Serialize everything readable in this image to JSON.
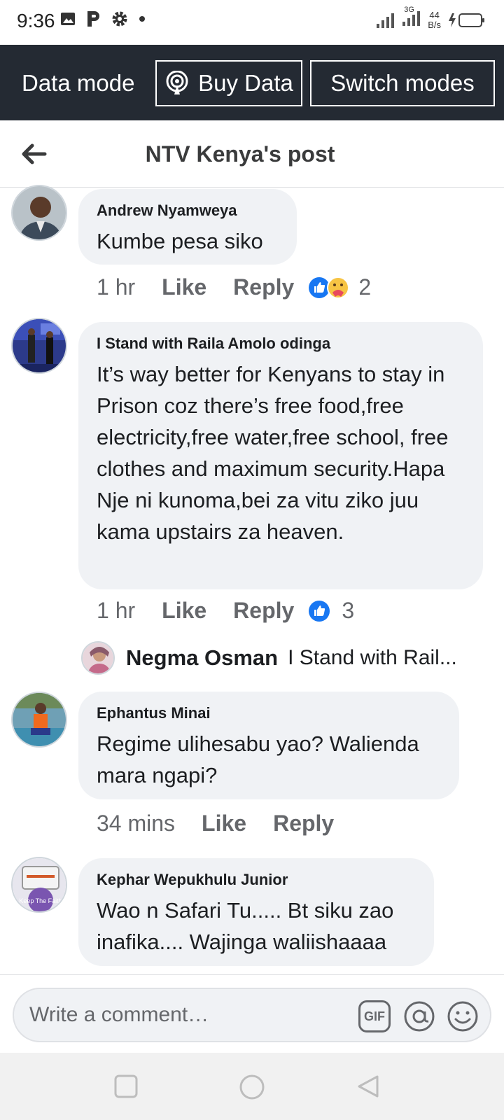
{
  "status_bar": {
    "time": "9:36",
    "network_label": "3G",
    "speed_value": "44",
    "speed_unit": "B/s"
  },
  "data_bar": {
    "mode_label": "Data mode",
    "buy_data_label": "Buy Data",
    "switch_modes_label": "Switch modes"
  },
  "header": {
    "title": "NTV Kenya's post"
  },
  "comments": [
    {
      "author": "Andrew Nyamweya",
      "text": "Kumbe pesa siko",
      "time": "1 hr",
      "like_label": "Like",
      "reply_label": "Reply",
      "reaction_count": "2"
    },
    {
      "author": "I Stand with Raila Amolo odinga",
      "text": "It’s way better for Kenyans to stay in Prison coz there’s free food,free electricity,free water,free school, free clothes and maximum security.Hapa Nje ni kunoma,bei za vitu ziko juu kama upstairs za heaven.",
      "time": "1 hr",
      "like_label": "Like",
      "reply_label": "Reply",
      "reaction_count": "3"
    },
    {
      "author": "Ephantus Minai",
      "text": "Regime ulihesabu yao? Walienda mara ngapi?",
      "time": "34 mins",
      "like_label": "Like",
      "reply_label": "Reply"
    },
    {
      "author": "Kephar Wepukhulu Junior",
      "text": "Wao n Safari Tu..... Bt siku zao inafika.... Wajinga waliishaaaa"
    }
  ],
  "reply_preview": {
    "author": "Negma Osman",
    "snippet": "I Stand with Rail..."
  },
  "avatar_labels": {
    "keep_faith": "Keep The Faith"
  },
  "comment_box": {
    "placeholder": "Write a comment…",
    "gif_label": "GIF"
  },
  "colors": {
    "data_bar_bg": "#242a33",
    "bubble_bg": "#f0f2f5",
    "like_blue": "#1877f2",
    "meta_gray": "#65676b"
  }
}
